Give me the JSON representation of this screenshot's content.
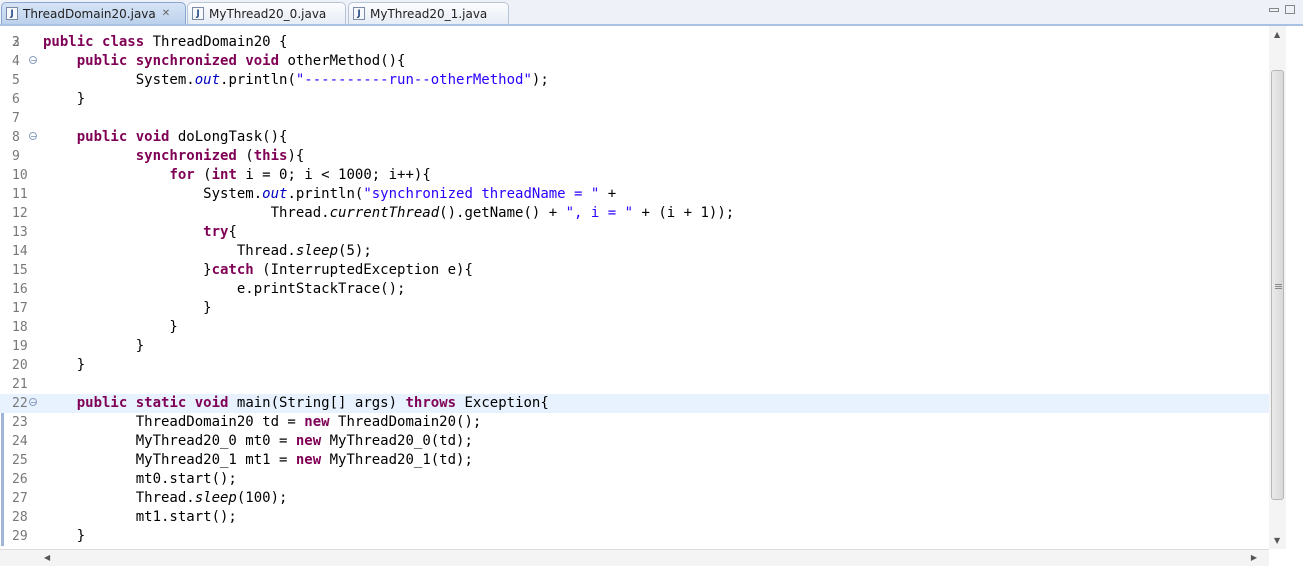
{
  "tabs": [
    {
      "label": "ThreadDomain20.java",
      "active": true,
      "icon": "java-file-icon",
      "closable": true
    },
    {
      "label": "MyThread20_0.java",
      "active": false,
      "icon": "java-file-icon"
    },
    {
      "label": "MyThread20_1.java",
      "active": false,
      "icon": "java-file-icon"
    }
  ],
  "editor": {
    "first_line_partial": "2",
    "current_line": 22,
    "colors": {
      "keyword": "#7f0055",
      "string": "#2a00ff",
      "static_field": "#0000c0",
      "current_line": "#e8f2fe",
      "line_number": "#787878"
    },
    "lines": [
      {
        "n": "3",
        "fold": false,
        "tokens": [
          {
            "t": "public",
            "c": "kw"
          },
          {
            "t": " "
          },
          {
            "t": "class",
            "c": "kw"
          },
          {
            "t": " ThreadDomain20 {"
          }
        ]
      },
      {
        "n": "4",
        "fold": true,
        "tokens": [
          {
            "t": "    "
          },
          {
            "t": "public",
            "c": "kw"
          },
          {
            "t": " "
          },
          {
            "t": "synchronized",
            "c": "kw"
          },
          {
            "t": " "
          },
          {
            "t": "void",
            "c": "kw"
          },
          {
            "t": " otherMethod(){"
          }
        ]
      },
      {
        "n": "5",
        "tokens": [
          {
            "t": "           System."
          },
          {
            "t": "out",
            "c": "it"
          },
          {
            "t": ".println("
          },
          {
            "t": "\"----------run--otherMethod\"",
            "c": "str"
          },
          {
            "t": ");"
          }
        ]
      },
      {
        "n": "6",
        "tokens": [
          {
            "t": "    }"
          }
        ]
      },
      {
        "n": "7",
        "tokens": []
      },
      {
        "n": "8",
        "fold": true,
        "tokens": [
          {
            "t": "    "
          },
          {
            "t": "public",
            "c": "kw"
          },
          {
            "t": " "
          },
          {
            "t": "void",
            "c": "kw"
          },
          {
            "t": " doLongTask(){"
          }
        ]
      },
      {
        "n": "9",
        "tokens": [
          {
            "t": "           "
          },
          {
            "t": "synchronized",
            "c": "kw"
          },
          {
            "t": " ("
          },
          {
            "t": "this",
            "c": "kw"
          },
          {
            "t": "){"
          }
        ]
      },
      {
        "n": "10",
        "tokens": [
          {
            "t": "               "
          },
          {
            "t": "for",
            "c": "kw"
          },
          {
            "t": " ("
          },
          {
            "t": "int",
            "c": "kw"
          },
          {
            "t": " i = 0; i < 1000; i++){"
          }
        ]
      },
      {
        "n": "11",
        "tokens": [
          {
            "t": "                   System."
          },
          {
            "t": "out",
            "c": "it"
          },
          {
            "t": ".println("
          },
          {
            "t": "\"synchronized threadName = \"",
            "c": "str"
          },
          {
            "t": " +"
          }
        ]
      },
      {
        "n": "12",
        "tokens": [
          {
            "t": "                           Thread."
          },
          {
            "t": "currentThread",
            "c": "sm"
          },
          {
            "t": "().getName() + "
          },
          {
            "t": "\", i = \"",
            "c": "str"
          },
          {
            "t": " + (i + 1));"
          }
        ]
      },
      {
        "n": "13",
        "tokens": [
          {
            "t": "                   "
          },
          {
            "t": "try",
            "c": "kw"
          },
          {
            "t": "{"
          }
        ]
      },
      {
        "n": "14",
        "tokens": [
          {
            "t": "                       Thread."
          },
          {
            "t": "sleep",
            "c": "sm"
          },
          {
            "t": "(5);"
          }
        ]
      },
      {
        "n": "15",
        "tokens": [
          {
            "t": "                   }"
          },
          {
            "t": "catch",
            "c": "kw"
          },
          {
            "t": " (InterruptedException e){"
          }
        ]
      },
      {
        "n": "16",
        "tokens": [
          {
            "t": "                       e.printStackTrace();"
          }
        ]
      },
      {
        "n": "17",
        "tokens": [
          {
            "t": "                   }"
          }
        ]
      },
      {
        "n": "18",
        "tokens": [
          {
            "t": "               }"
          }
        ]
      },
      {
        "n": "19",
        "tokens": [
          {
            "t": "           }"
          }
        ]
      },
      {
        "n": "20",
        "tokens": [
          {
            "t": "    }"
          }
        ]
      },
      {
        "n": "21",
        "tokens": []
      },
      {
        "n": "22",
        "fold": true,
        "tokens": [
          {
            "t": "    "
          },
          {
            "t": "public",
            "c": "kw"
          },
          {
            "t": " "
          },
          {
            "t": "static",
            "c": "kw"
          },
          {
            "t": " "
          },
          {
            "t": "void",
            "c": "kw"
          },
          {
            "t": " main(String[] args) "
          },
          {
            "t": "throws",
            "c": "kw"
          },
          {
            "t": " Exception{"
          }
        ]
      },
      {
        "n": "23",
        "tokens": [
          {
            "t": "           ThreadDomain20 td = "
          },
          {
            "t": "new",
            "c": "kw"
          },
          {
            "t": " ThreadDomain20();"
          }
        ]
      },
      {
        "n": "24",
        "tokens": [
          {
            "t": "           MyThread20_0 mt0 = "
          },
          {
            "t": "new",
            "c": "kw"
          },
          {
            "t": " MyThread20_0(td);"
          }
        ]
      },
      {
        "n": "25",
        "tokens": [
          {
            "t": "           MyThread20_1 mt1 = "
          },
          {
            "t": "new",
            "c": "kw"
          },
          {
            "t": " MyThread20_1(td);"
          }
        ]
      },
      {
        "n": "26",
        "tokens": [
          {
            "t": "           mt0.start();"
          }
        ]
      },
      {
        "n": "27",
        "tokens": [
          {
            "t": "           Thread."
          },
          {
            "t": "sleep",
            "c": "sm"
          },
          {
            "t": "(100);"
          }
        ]
      },
      {
        "n": "28",
        "tokens": [
          {
            "t": "           mt1.start();"
          }
        ]
      },
      {
        "n": "29",
        "tokens": [
          {
            "t": "    }"
          }
        ]
      }
    ]
  },
  "vertical_scroll_fraction": 0.1
}
